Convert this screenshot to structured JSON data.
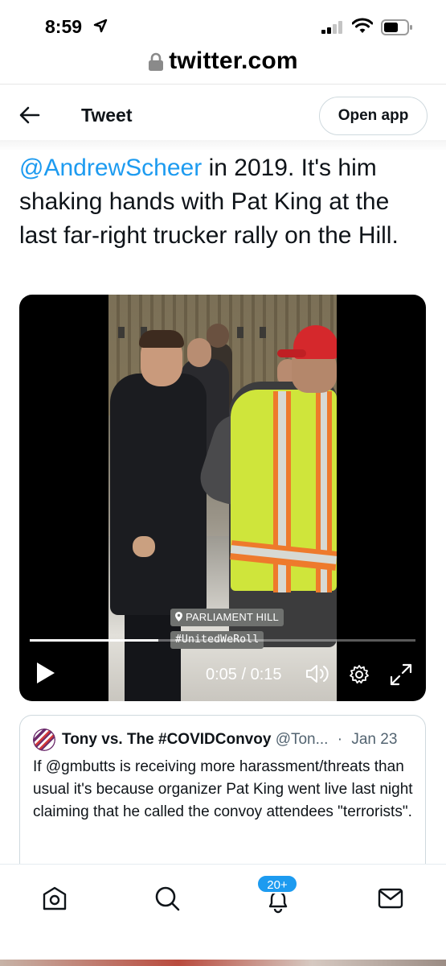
{
  "status_bar": {
    "time": "8:59",
    "icons": [
      "location-arrow-icon",
      "signal-icon",
      "wifi-icon",
      "battery-icon"
    ]
  },
  "url_bar": {
    "domain": "twitter.com",
    "icon": "lock-icon"
  },
  "header": {
    "title": "Tweet",
    "open_app_label": "Open app",
    "back_icon": "back-arrow-icon"
  },
  "tweet": {
    "mention": "@AndrewScheer",
    "text_after_mention": " in 2019. It's him shaking hands with Pat King at the last far-right trucker rally on the Hill."
  },
  "video": {
    "sticker_location": "PARLIAMENT HILL",
    "sticker_hashtag": "#UnitedWeRoll",
    "time_display": "0:05 / 0:15",
    "progress": 0.333,
    "controls": [
      "play-icon",
      "volume-icon",
      "settings-gear-icon",
      "expand-icon"
    ]
  },
  "quoted_tweet": {
    "name": "Tony vs. The #COVIDConvoy",
    "handle": "@Ton...",
    "separator": "·",
    "date": "Jan 23",
    "text": "If @gmbutts is receiving more harassment/threats than usual it's because organizer Pat King went live last night claiming that he called the convoy attendees \"terrorists\"."
  },
  "bottom_nav": {
    "items": [
      "home-icon",
      "search-icon",
      "notifications-icon",
      "messages-icon"
    ],
    "notification_badge": "20+"
  },
  "colors": {
    "accent": "#1d9bf0",
    "text": "#0f1419",
    "secondary_text": "#536471",
    "border": "#cfd9de"
  }
}
